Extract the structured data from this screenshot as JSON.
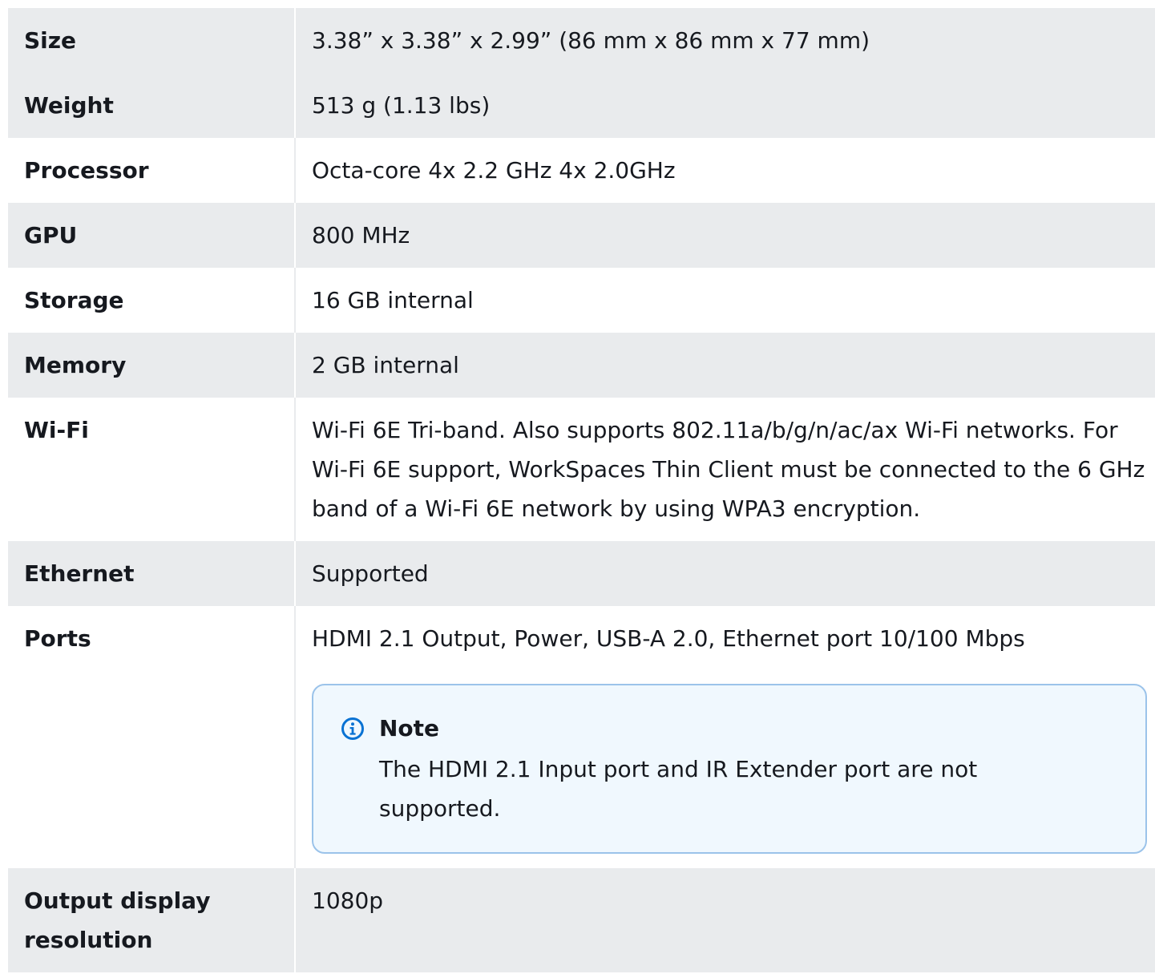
{
  "specs": [
    {
      "label": "Size",
      "value": "3.38” x 3.38” x 2.99” (86 mm x 86 mm x 77 mm)"
    },
    {
      "label": "Weight",
      "value": "513 g (1.13 lbs)"
    },
    {
      "label": "Processor",
      "value": "Octa-core 4x 2.2 GHz 4x 2.0GHz"
    },
    {
      "label": "GPU",
      "value": "800 MHz"
    },
    {
      "label": "Storage",
      "value": "16 GB internal"
    },
    {
      "label": "Memory",
      "value": "2 GB internal"
    },
    {
      "label": "Wi-Fi",
      "value": "Wi-Fi 6E Tri-band. Also supports 802.11a/b/g/n/ac/ax Wi-Fi networks. For Wi-Fi 6E support, WorkSpaces Thin Client must be connected to the 6 GHz band of a Wi-Fi 6E network by using WPA3 encryption."
    },
    {
      "label": "Ethernet",
      "value": "Supported"
    },
    {
      "label": "Ports",
      "value": "HDMI 2.1 Output, Power, USB-A 2.0, Ethernet port 10/100 Mbps"
    },
    {
      "label": "Output display resolution",
      "value": "1080p"
    }
  ],
  "ports_note": {
    "title": "Note",
    "body": "The HDMI 2.1 Input port and IR Extender port are not supported.",
    "icon": "info-icon"
  },
  "colors": {
    "row_shade": "#e9ebed",
    "note_background": "#f0f8fe",
    "note_border": "#9bc3ea",
    "info_icon": "#0972d3"
  }
}
